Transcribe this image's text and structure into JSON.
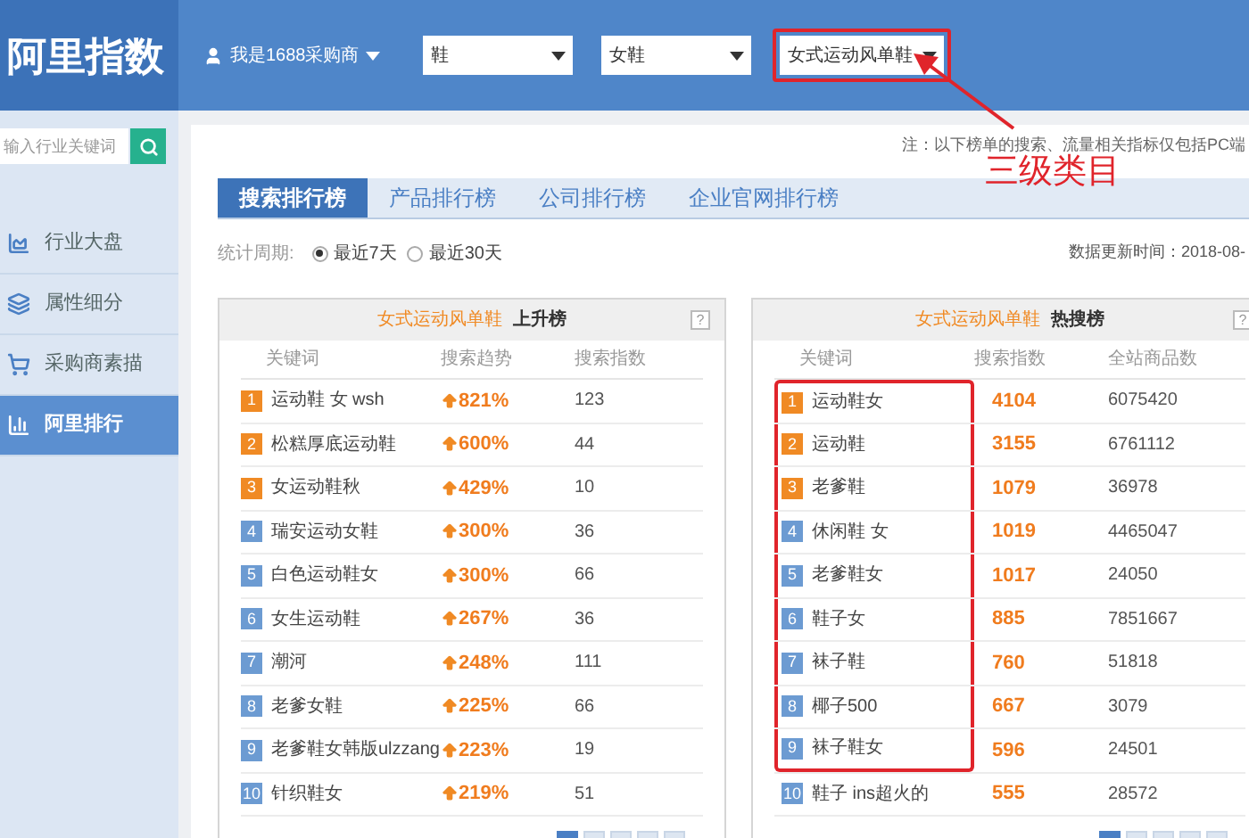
{
  "header": {
    "logo": "阿里指数",
    "user": "我是1688采购商",
    "dropdowns": [
      {
        "value": "鞋",
        "highlighted": false
      },
      {
        "value": "女鞋",
        "highlighted": false
      },
      {
        "value": "女式运动风单鞋",
        "highlighted": true
      }
    ]
  },
  "annotation": {
    "label": "三级类目"
  },
  "sidebar": {
    "search_placeholder": "输入行业关键词",
    "items": [
      {
        "label": "行业大盘",
        "kind": "area",
        "selected": false
      },
      {
        "label": "属性细分",
        "kind": "layers",
        "selected": false
      },
      {
        "label": "采购商素描",
        "kind": "cart",
        "selected": false
      },
      {
        "label": "阿里排行",
        "kind": "bars",
        "selected": true
      }
    ]
  },
  "notice": "注：以下榜单的搜索、流量相关指标仅包括PC端",
  "tabs": [
    {
      "label": "搜索排行榜",
      "selected": true
    },
    {
      "label": "产品排行榜",
      "selected": false
    },
    {
      "label": "公司排行榜",
      "selected": false
    },
    {
      "label": "企业官网排行榜",
      "selected": false
    }
  ],
  "period": {
    "label": "统计周期:",
    "options": [
      {
        "label": "最近7天",
        "selected": true
      },
      {
        "label": "最近30天",
        "selected": false
      }
    ]
  },
  "updated": "数据更新时间：2018-08-",
  "rising": {
    "category": "女式运动风单鞋",
    "title": "上升榜",
    "help": "?",
    "columns": [
      "关键词",
      "搜索趋势",
      "搜索指数"
    ],
    "rows": [
      {
        "rank": "1",
        "color": "#f08a24",
        "keyword": "运动鞋 女 wsh",
        "trend": "821%",
        "index": "123"
      },
      {
        "rank": "2",
        "color": "#f08a24",
        "keyword": "松糕厚底运动鞋",
        "trend": "600%",
        "index": "44"
      },
      {
        "rank": "3",
        "color": "#f08a24",
        "keyword": "女运动鞋秋",
        "trend": "429%",
        "index": "10"
      },
      {
        "rank": "4",
        "color": "#6c9bd2",
        "keyword": "瑞安运动女鞋",
        "trend": "300%",
        "index": "36"
      },
      {
        "rank": "5",
        "color": "#6c9bd2",
        "keyword": "白色运动鞋女",
        "trend": "300%",
        "index": "66"
      },
      {
        "rank": "6",
        "color": "#6c9bd2",
        "keyword": "女生运动鞋",
        "trend": "267%",
        "index": "36"
      },
      {
        "rank": "7",
        "color": "#6c9bd2",
        "keyword": "潮河",
        "trend": "248%",
        "index": "111"
      },
      {
        "rank": "8",
        "color": "#6c9bd2",
        "keyword": "老爹女鞋",
        "trend": "225%",
        "index": "66"
      },
      {
        "rank": "9",
        "color": "#6c9bd2",
        "keyword": "老爹鞋女韩版ulzzang",
        "trend": "223%",
        "index": "19"
      },
      {
        "rank": "10",
        "color": "#6c9bd2",
        "keyword": "针织鞋女",
        "trend": "219%",
        "index": "51"
      }
    ],
    "pages": [
      {
        "selected": true
      },
      {
        "selected": false
      },
      {
        "selected": false
      },
      {
        "selected": false
      },
      {
        "selected": false
      }
    ]
  },
  "hot": {
    "category": "女式运动风单鞋",
    "title": "热搜榜",
    "help": "?",
    "columns": [
      "关键词",
      "搜索指数",
      "全站商品数"
    ],
    "rows": [
      {
        "rank": "1",
        "color": "#f08a24",
        "keyword": "运动鞋女",
        "index": "4104",
        "total": "6075420",
        "highlighted": true
      },
      {
        "rank": "2",
        "color": "#f08a24",
        "keyword": "运动鞋",
        "index": "3155",
        "total": "6761112",
        "highlighted": true
      },
      {
        "rank": "3",
        "color": "#f08a24",
        "keyword": "老爹鞋",
        "index": "1079",
        "total": "36978",
        "highlighted": true
      },
      {
        "rank": "4",
        "color": "#6c9bd2",
        "keyword": "休闲鞋 女",
        "index": "1019",
        "total": "4465047",
        "highlighted": true
      },
      {
        "rank": "5",
        "color": "#6c9bd2",
        "keyword": "老爹鞋女",
        "index": "1017",
        "total": "24050",
        "highlighted": true
      },
      {
        "rank": "6",
        "color": "#6c9bd2",
        "keyword": "鞋子女",
        "index": "885",
        "total": "7851667",
        "highlighted": true
      },
      {
        "rank": "7",
        "color": "#6c9bd2",
        "keyword": "袜子鞋",
        "index": "760",
        "total": "51818",
        "highlighted": true
      },
      {
        "rank": "8",
        "color": "#6c9bd2",
        "keyword": "椰子500",
        "index": "667",
        "total": "3079",
        "highlighted": true
      },
      {
        "rank": "9",
        "color": "#6c9bd2",
        "keyword": "袜子鞋女",
        "index": "596",
        "total": "24501",
        "highlighted": true
      },
      {
        "rank": "10",
        "color": "#6c9bd2",
        "keyword": "鞋子 ins超火的",
        "index": "555",
        "total": "28572",
        "highlighted": false
      }
    ],
    "pages": [
      {
        "selected": true
      },
      {
        "selected": false
      },
      {
        "selected": false
      },
      {
        "selected": false
      },
      {
        "selected": false
      }
    ]
  }
}
